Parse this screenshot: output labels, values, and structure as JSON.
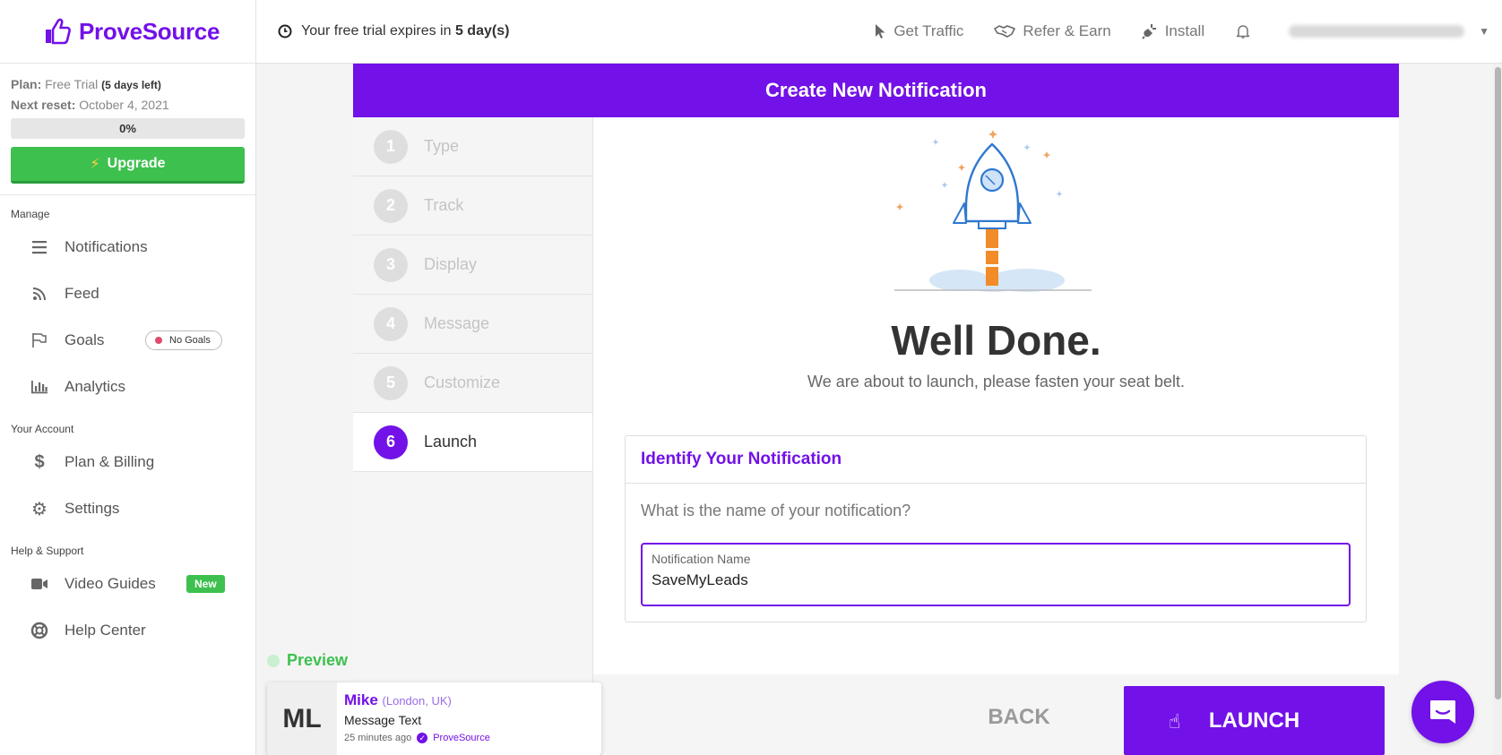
{
  "brand": {
    "name": "ProveSource",
    "accent": "#7211e8",
    "green": "#3ec04f"
  },
  "sidebar": {
    "plan_label": "Plan:",
    "plan_value": "Free Trial",
    "plan_days": "(5 days left)",
    "reset_label": "Next reset:",
    "reset_value": "October 4, 2021",
    "usage_percent": 0,
    "usage_label": "0%",
    "upgrade_label": "Upgrade",
    "sections": {
      "manage": "Manage",
      "account": "Your Account",
      "help": "Help & Support"
    },
    "items": {
      "notifications": "Notifications",
      "feed": "Feed",
      "goals": "Goals",
      "goals_badge": "No Goals",
      "analytics": "Analytics",
      "billing": "Plan & Billing",
      "settings": "Settings",
      "video_guides": "Video Guides",
      "video_badge": "New",
      "help_center": "Help Center"
    }
  },
  "topbar": {
    "trial_prefix": "Your free trial expires in",
    "trial_days": "5 day(s)",
    "get_traffic": "Get Traffic",
    "refer": "Refer & Earn",
    "install": "Install"
  },
  "wizard": {
    "title": "Create New Notification",
    "steps": [
      {
        "num": "1",
        "label": "Type"
      },
      {
        "num": "2",
        "label": "Track"
      },
      {
        "num": "3",
        "label": "Display"
      },
      {
        "num": "4",
        "label": "Message"
      },
      {
        "num": "5",
        "label": "Customize"
      },
      {
        "num": "6",
        "label": "Launch"
      }
    ],
    "heading": "Well Done.",
    "subtitle": "We are about to launch, please fasten your seat belt.",
    "identify_title": "Identify Your Notification",
    "identify_question": "What is the name of your notification?",
    "name_label": "Notification Name",
    "name_value": "SaveMyLeads",
    "back_label": "BACK",
    "launch_label": "LAUNCH"
  },
  "preview": {
    "label": "Preview",
    "initials": "ML",
    "name": "Mike",
    "location": "(London, UK)",
    "message": "Message Text",
    "time": "25 minutes ago",
    "brand": "ProveSource"
  }
}
